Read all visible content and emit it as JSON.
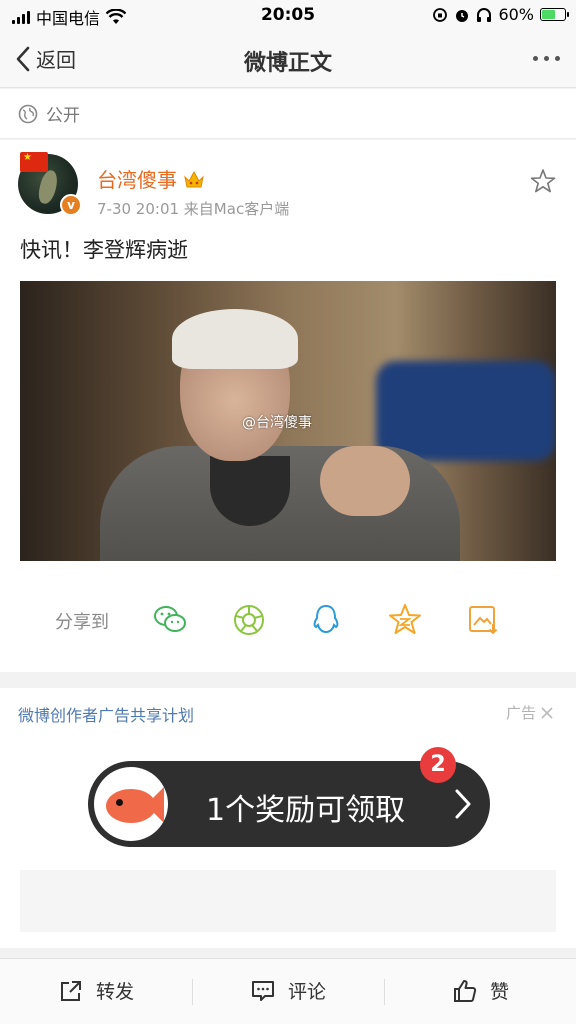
{
  "status_bar": {
    "carrier": "中国电信",
    "time": "20:05",
    "battery_pct": "60%",
    "battery_level": 0.6
  },
  "nav": {
    "back_label": "返回",
    "title": "微博正文"
  },
  "visibility": {
    "label": "公开"
  },
  "post": {
    "author": "台湾傻事",
    "verified_mark": "v",
    "meta": "7-30 20:01  来自Mac客户端",
    "text": "快讯！李登辉病逝",
    "image_watermark": "@台湾傻事",
    "share_label": "分享到",
    "share_targets": [
      "wechat-icon",
      "moments-icon",
      "qq-icon",
      "qzone-icon",
      "save-image-icon"
    ]
  },
  "ad": {
    "title": "微博创作者广告共享计划",
    "tag": "广告",
    "reward_text": "1个奖励可领取",
    "badge_count": "2"
  },
  "toolbar": {
    "repost": "转发",
    "comment": "评论",
    "like": "赞"
  },
  "colors": {
    "username": "#e86b22",
    "ad_title": "#4f7ab0",
    "badge": "#e93c3c"
  }
}
